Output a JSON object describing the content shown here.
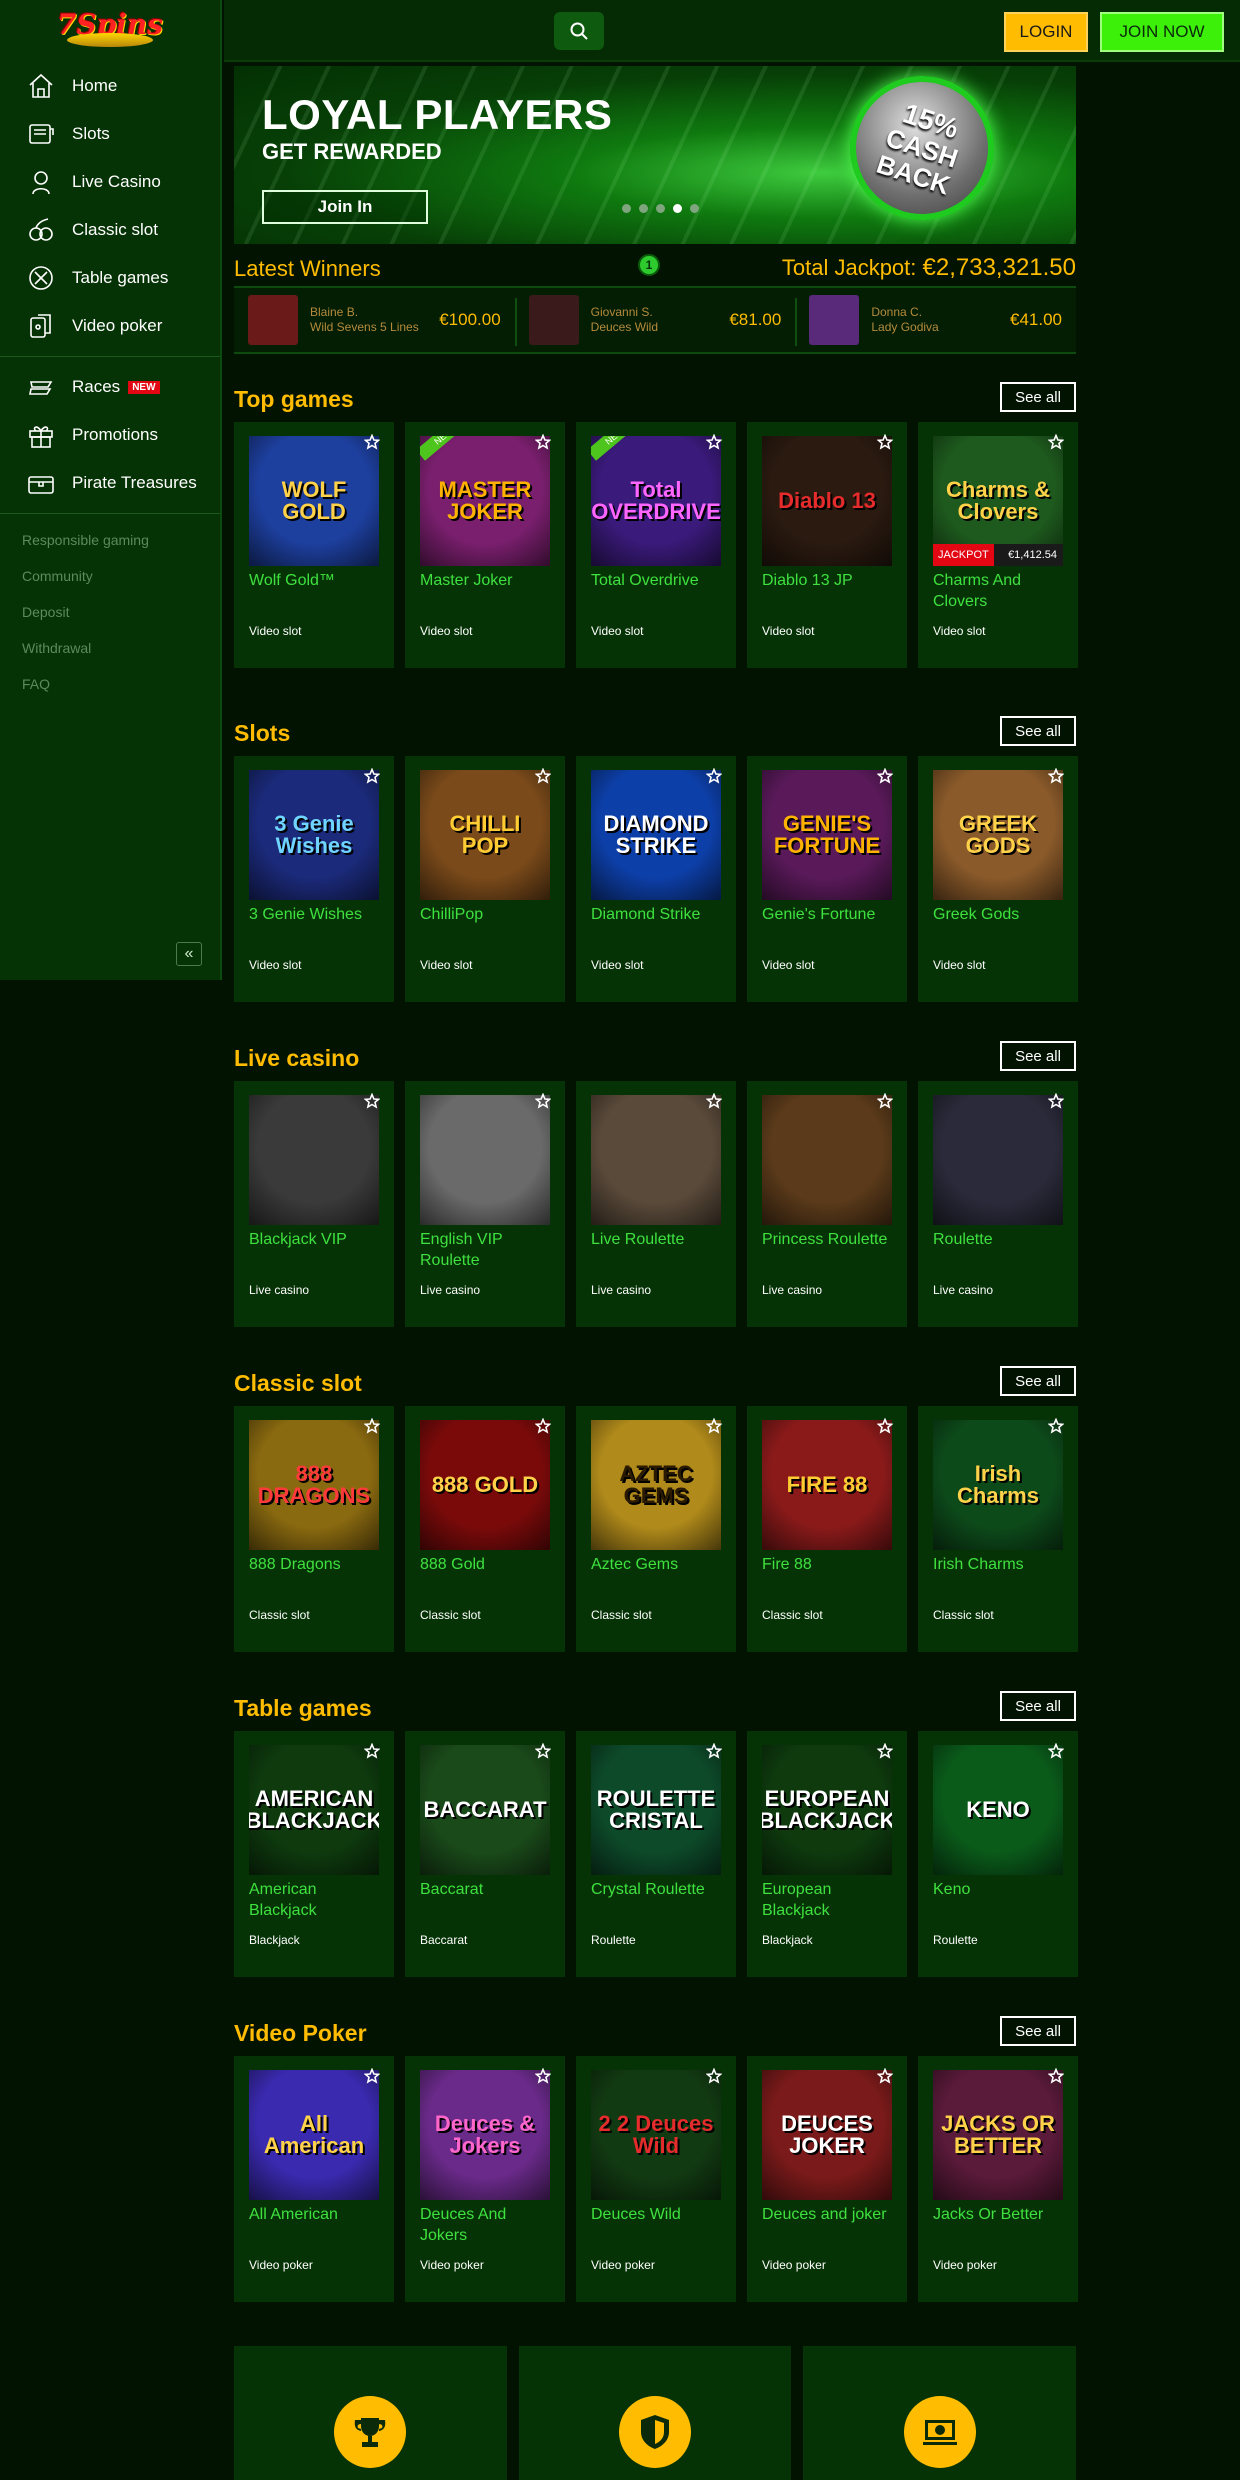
{
  "brand": {
    "logo": "7Spins"
  },
  "sidebar": {
    "items": [
      {
        "label": "Home",
        "icon": "home-icon"
      },
      {
        "label": "Slots",
        "icon": "slots-icon"
      },
      {
        "label": "Live Casino",
        "icon": "live-casino-icon"
      },
      {
        "label": "Classic slot",
        "icon": "classic-slot-icon"
      },
      {
        "label": "Table games",
        "icon": "table-games-icon"
      },
      {
        "label": "Video poker",
        "icon": "video-poker-icon"
      }
    ],
    "items2": [
      {
        "label": "Races",
        "icon": "races-icon",
        "badge": "NEW"
      },
      {
        "label": "Promotions",
        "icon": "gift-icon"
      },
      {
        "label": "Pirate Treasures",
        "icon": "treasure-icon"
      }
    ],
    "links": [
      "Responsible gaming",
      "Community",
      "Deposit",
      "Withdrawal",
      "FAQ"
    ],
    "collapse": "«"
  },
  "header": {
    "login": "LOGIN",
    "join": "JOIN NOW"
  },
  "banner": {
    "headline": "LOYAL PLAYERS",
    "subline": "GET REWARDED",
    "cta": "Join In",
    "badge_pct": "15%",
    "badge_line1": "CASH",
    "badge_line2": "BACK",
    "slide_count": 5,
    "active_slide": 4
  },
  "winners": {
    "title": "Latest Winners",
    "crown": "1",
    "jackpot_label": "Total Jackpot:",
    "jackpot_value": "€2,733,321.50",
    "entries": [
      {
        "name": "Blaine B.",
        "game": "Wild Sevens 5 Lines",
        "amount": "€100.00"
      },
      {
        "name": "Giovanni S.",
        "game": "Deuces Wild",
        "amount": "€81.00"
      },
      {
        "name": "Donna C.",
        "game": "Lady Godiva",
        "amount": "€41.00"
      }
    ]
  },
  "see_all": "See all",
  "sections": [
    {
      "title": "Top games",
      "games": [
        {
          "name": "Wolf Gold™",
          "cat": "Video slot",
          "art": "WOLF GOLD",
          "bg": "#1d3f9e",
          "fg": "#ffd24a"
        },
        {
          "name": "Master Joker",
          "cat": "Video slot",
          "art": "MASTER JOKER",
          "bg": "#7a1f6e",
          "fg": "#ffb300",
          "ribbon": "NEW"
        },
        {
          "name": "Total Overdrive",
          "cat": "Video slot",
          "art": "Total OVERDRIVE",
          "bg": "#3a1a7a",
          "fg": "#ff66ff",
          "ribbon": "NEW"
        },
        {
          "name": "Diablo 13 JP",
          "cat": "Video slot",
          "art": "Diablo 13",
          "bg": "#2a1a10",
          "fg": "#e52b2b"
        },
        {
          "name": "Charms And Clovers",
          "cat": "Video slot",
          "art": "Charms & Clovers",
          "bg": "#1e5a1e",
          "fg": "#ffd24a",
          "jackpot_label": "JACKPOT",
          "jackpot_value": "€1,412.54"
        }
      ]
    },
    {
      "title": "Slots",
      "games": [
        {
          "name": "3 Genie Wishes",
          "cat": "Video slot",
          "art": "3 Genie Wishes",
          "bg": "#1b2a7a",
          "fg": "#6fd4ff"
        },
        {
          "name": "ChilliPop",
          "cat": "Video slot",
          "art": "CHILLI POP",
          "bg": "#7a4a1a",
          "fg": "#ffcc33"
        },
        {
          "name": "Diamond Strike",
          "cat": "Video slot",
          "art": "DIAMOND STRIKE",
          "bg": "#0d3fa8",
          "fg": "#ffffff"
        },
        {
          "name": "Genie's Fortune",
          "cat": "Video slot",
          "art": "GENIE'S FORTUNE",
          "bg": "#5a1a5a",
          "fg": "#ffb300"
        },
        {
          "name": "Greek Gods",
          "cat": "Video slot",
          "art": "GREEK GODS",
          "bg": "#8a5a2a",
          "fg": "#ffd24a"
        }
      ]
    },
    {
      "title": "Live casino",
      "games": [
        {
          "name": "Blackjack VIP",
          "cat": "Live casino",
          "art": "",
          "bg": "#3a3a3a",
          "fg": "#ffffff"
        },
        {
          "name": "English VIP Roulette",
          "cat": "Live casino",
          "art": "",
          "bg": "#6a6a6a",
          "fg": "#ffffff"
        },
        {
          "name": "Live Roulette",
          "cat": "Live casino",
          "art": "",
          "bg": "#5a4a3a",
          "fg": "#ffffff"
        },
        {
          "name": "Princess Roulette",
          "cat": "Live casino",
          "art": "",
          "bg": "#5a3a1a",
          "fg": "#ffffff"
        },
        {
          "name": "Roulette",
          "cat": "Live casino",
          "art": "",
          "bg": "#2a2a3a",
          "fg": "#ffffff"
        }
      ]
    },
    {
      "title": "Classic slot",
      "games": [
        {
          "name": "888 Dragons",
          "cat": "Classic slot",
          "art": "888 DRAGONS",
          "bg": "#8a6a10",
          "fg": "#ff3a3a"
        },
        {
          "name": "888 Gold",
          "cat": "Classic slot",
          "art": "888 GOLD",
          "bg": "#7a0a0a",
          "fg": "#ffd24a"
        },
        {
          "name": "Aztec Gems",
          "cat": "Classic slot",
          "art": "AZTEC GEMS",
          "bg": "#b08a1a",
          "fg": "#2a1a00"
        },
        {
          "name": "Fire 88",
          "cat": "Classic slot",
          "art": "FIRE 88",
          "bg": "#8a1a1a",
          "fg": "#ffcc33"
        },
        {
          "name": "Irish Charms",
          "cat": "Classic slot",
          "art": "Irish Charms",
          "bg": "#0d4a1a",
          "fg": "#ffd24a"
        }
      ]
    },
    {
      "title": "Table games",
      "games": [
        {
          "name": "American Blackjack",
          "cat": "Blackjack",
          "art": "AMERICAN BLACKJACK",
          "bg": "#0e3a0e",
          "fg": "#ffffff"
        },
        {
          "name": "Baccarat",
          "cat": "Baccarat",
          "art": "BACCARAT",
          "bg": "#1a4a1a",
          "fg": "#ffffff"
        },
        {
          "name": "Crystal Roulette",
          "cat": "Roulette",
          "art": "ROULETTE CRISTAL",
          "bg": "#0d4a2a",
          "fg": "#ffffff"
        },
        {
          "name": "European Blackjack",
          "cat": "Blackjack",
          "art": "EUROPEAN BLACKJACK",
          "bg": "#0e3a0e",
          "fg": "#ffffff"
        },
        {
          "name": "Keno",
          "cat": "Roulette",
          "art": "KENO",
          "bg": "#0a5a1a",
          "fg": "#ffffff"
        }
      ]
    },
    {
      "title": "Video Poker",
      "games": [
        {
          "name": "All American",
          "cat": "Video poker",
          "art": "All American",
          "bg": "#3a2ab0",
          "fg": "#ffd24a"
        },
        {
          "name": "Deuces And Jokers",
          "cat": "Video poker",
          "art": "Deuces & Jokers",
          "bg": "#6a2a8a",
          "fg": "#ff66cc"
        },
        {
          "name": "Deuces Wild",
          "cat": "Video poker",
          "art": "2 2 Deuces Wild",
          "bg": "#123a12",
          "fg": "#e52b2b"
        },
        {
          "name": "Deuces and joker",
          "cat": "Video poker",
          "art": "DEUCES JOKER",
          "bg": "#7a1a1a",
          "fg": "#ffffff"
        },
        {
          "name": "Jacks Or Better",
          "cat": "Video poker",
          "art": "JACKS OR BETTER",
          "bg": "#5a1a3a",
          "fg": "#ffd24a"
        }
      ]
    }
  ],
  "features": [
    {
      "icon": "trophy-icon"
    },
    {
      "icon": "shield-icon"
    },
    {
      "icon": "payment-icon"
    }
  ],
  "colors": {
    "accent": "#ffbc00",
    "green_link": "#3ee13e",
    "join": "#3cf00a"
  }
}
